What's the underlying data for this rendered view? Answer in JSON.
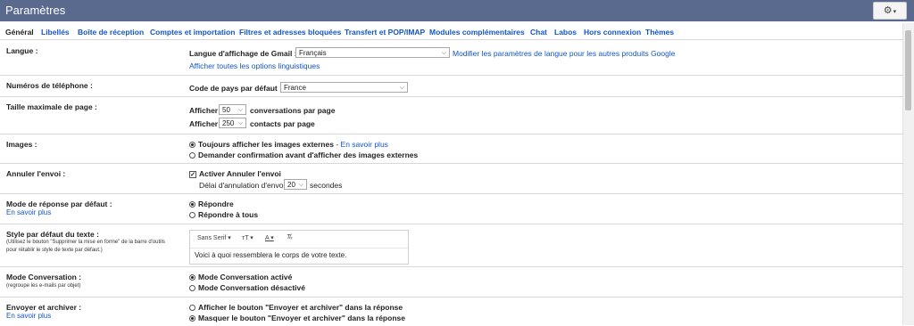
{
  "header": {
    "title": "Paramètres",
    "settings_icon": "gear-icon"
  },
  "tabs": [
    "Général",
    "Libellés",
    "Boîte de réception",
    "Comptes et importation",
    "Filtres et adresses bloquées",
    "Transfert et POP/IMAP",
    "Modules complémentaires",
    "Chat",
    "Labos",
    "Hors connexion",
    "Thèmes"
  ],
  "language": {
    "label": "Langue :",
    "field_label": "Langue d'affichage de Gmail :",
    "value": "Français",
    "link_other": "Modifier les paramètres de langue pour les autres produits Google",
    "link_all": "Afficher toutes les options linguistiques"
  },
  "phone": {
    "label": "Numéros de téléphone :",
    "field_label": "Code de pays par défaut :",
    "value": "France"
  },
  "page_size": {
    "label": "Taille maximale de page :",
    "show": "Afficher",
    "conv_value": "50",
    "conv_suffix": "conversations par page",
    "contacts_value": "250",
    "contacts_suffix": "contacts par page"
  },
  "images": {
    "label": "Images :",
    "opt1": "Toujours afficher les images externes",
    "opt1_sep": " - ",
    "opt1_link": "En savoir plus",
    "opt2": "Demander confirmation avant d'afficher des images externes",
    "selected": 1
  },
  "undo_send": {
    "label": "Annuler l'envoi :",
    "checkbox_label": "Activer Annuler l'envoi",
    "checked": true,
    "delay_label": "Délai d'annulation d'envoi :",
    "delay_value": "20",
    "delay_suffix": "secondes"
  },
  "reply_mode": {
    "label": "Mode de réponse par défaut :",
    "learn_more": "En savoir plus",
    "opt1": "Répondre",
    "opt2": "Répondre à tous",
    "selected": 1
  },
  "text_style": {
    "label": "Style par défaut du texte :",
    "note": "(Utilisez le bouton \"Supprimer la mise en forme\" de la barre d'outils pour rétablir le style de texte par défaut.)",
    "font": "Sans Serif",
    "preview": "Voici à quoi ressemblera le corps de votre texte."
  },
  "conversation": {
    "label": "Mode Conversation :",
    "note": "(regroupe les e-mails par objet)",
    "opt1": "Mode Conversation activé",
    "opt2": "Mode Conversation désactivé",
    "selected": 1
  },
  "send_archive": {
    "label": "Envoyer et archiver :",
    "learn_more": "En savoir plus",
    "opt1": "Afficher le bouton \"Envoyer et archiver\" dans la réponse",
    "opt2": "Masquer le bouton \"Envoyer et archiver\" dans la réponse",
    "selected": 2
  }
}
